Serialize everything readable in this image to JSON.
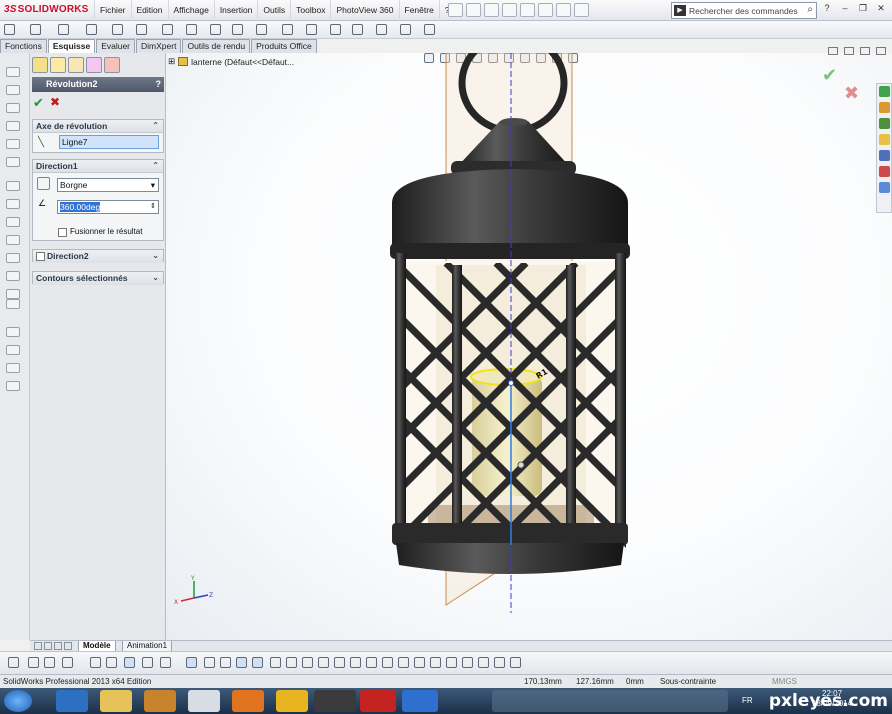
{
  "app": {
    "logo_text": "SOLIDWORKS",
    "logo_ds": "3S"
  },
  "menu": [
    "Fichier",
    "Edition",
    "Affichage",
    "Insertion",
    "Outils",
    "Toolbox",
    "PhotoView 360",
    "Fenêtre",
    "?"
  ],
  "search": {
    "placeholder": "Rechercher des commandes"
  },
  "tabs": [
    {
      "label": "Fonctions",
      "active": false
    },
    {
      "label": "Esquisse",
      "active": true
    },
    {
      "label": "Evaluer",
      "active": false
    },
    {
      "label": "DimXpert",
      "active": false
    },
    {
      "label": "Outils de rendu",
      "active": false
    },
    {
      "label": "Produits Office",
      "active": false
    }
  ],
  "property_manager": {
    "title": "Révolution2",
    "help": "?",
    "axis_group": {
      "title": "Axe de révolution",
      "value": "Ligne7"
    },
    "direction1": {
      "title": "Direction1",
      "type_value": "Borgne",
      "angle_value": "360.00deg",
      "merge_label": "Fusionner le résultat"
    },
    "direction2": {
      "title": "Direction2"
    },
    "contours": {
      "title": "Contours sélectionnés"
    }
  },
  "tree": {
    "item": "lanterne  (Défaut<<Défaut..."
  },
  "model_tabs": [
    {
      "label": "Modèle",
      "active": true
    },
    {
      "label": "Animation1",
      "active": false
    }
  ],
  "status": {
    "app_name": "SolidWorks Professional 2013 x64 Edition",
    "x": "170.13mm",
    "y": "127.16mm",
    "z": "0mm",
    "state": "Sous-contrainte",
    "units": "MMGS"
  },
  "taskbar": {
    "lang": "FR",
    "time": "22:07",
    "date": "18/09/2014",
    "watermark": "pxleyes.com"
  },
  "colors": {
    "lantern_metal": "#2b2b2b",
    "sketch_selection": "#f2e21a",
    "plane": "#c98a4a",
    "axis": "#3b3bd6"
  }
}
